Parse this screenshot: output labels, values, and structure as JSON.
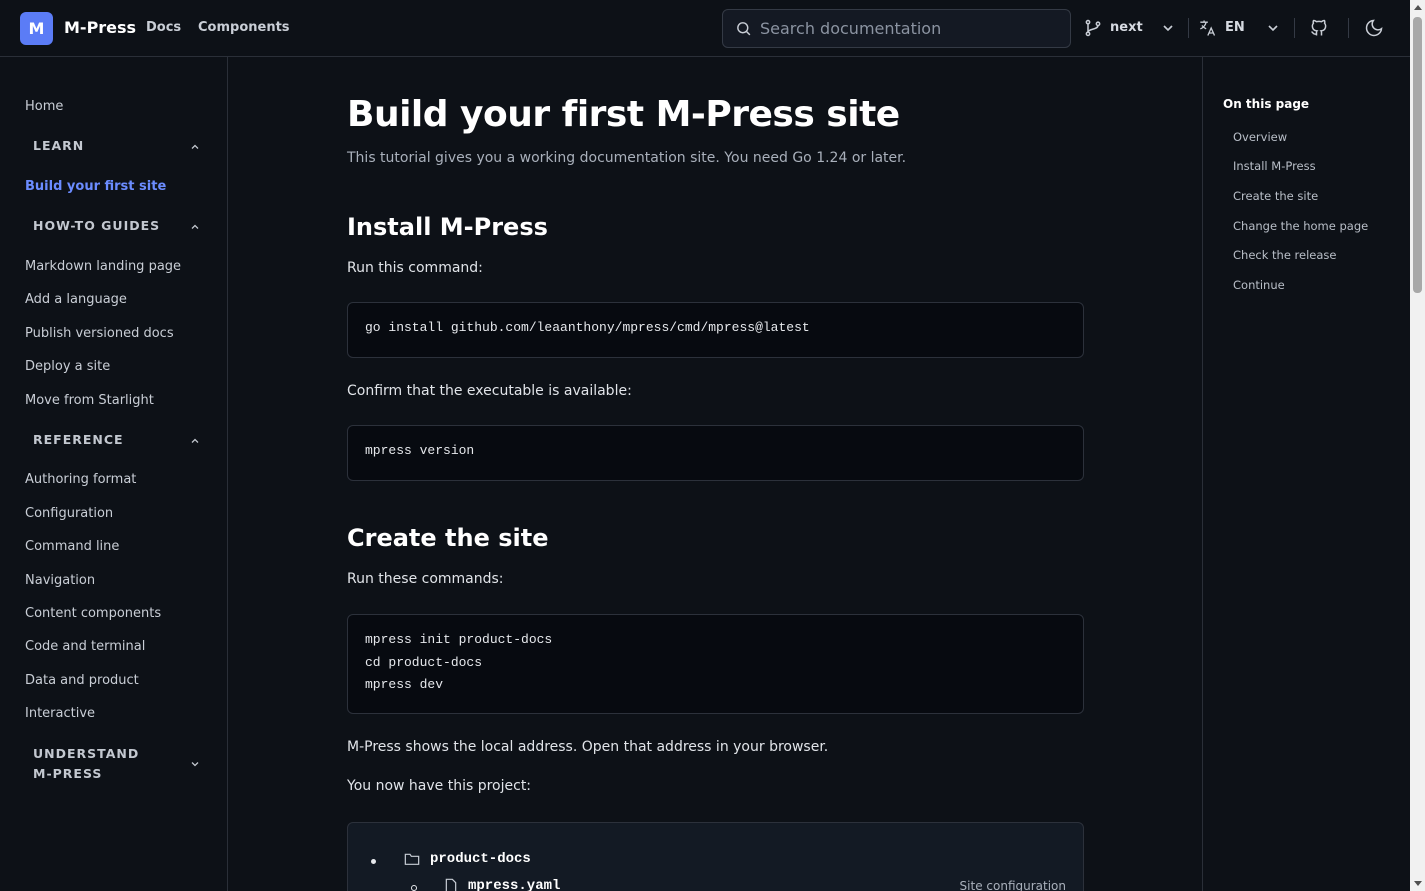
{
  "header": {
    "logo_letter": "M",
    "brand": "M-Press",
    "nav": [
      "Docs",
      "Components"
    ],
    "search_placeholder": "Search documentation",
    "version": "next",
    "language": "EN"
  },
  "sidebar": {
    "home": "Home",
    "groups": [
      {
        "title": "LEARN",
        "expanded": true,
        "items": [
          "Build your first site"
        ]
      },
      {
        "title": "HOW-TO GUIDES",
        "expanded": true,
        "items": [
          "Markdown landing page",
          "Add a language",
          "Publish versioned docs",
          "Deploy a site",
          "Move from Starlight"
        ]
      },
      {
        "title": "REFERENCE",
        "expanded": true,
        "items": [
          "Authoring format",
          "Configuration",
          "Command line",
          "Navigation",
          "Content components",
          "Code and terminal",
          "Data and product",
          "Interactive"
        ]
      },
      {
        "title": "UNDERSTAND M-PRESS",
        "expanded": false,
        "items": []
      }
    ],
    "active_item": "Build your first site"
  },
  "content": {
    "title": "Build your first M-Press site",
    "lede": "This tutorial gives you a working documentation site. You need Go 1.24 or later.",
    "install_heading": "Install M-Press",
    "install_intro": "Run this command:",
    "install_code": [
      "go install github.com/leaanthony/mpress/cmd/mpress@latest"
    ],
    "confirm_text": "Confirm that the executable is available:",
    "confirm_code": [
      "mpress version"
    ],
    "create_heading": "Create the site",
    "create_intro": "Run these commands:",
    "create_code": [
      "mpress init product-docs",
      "cd product-docs",
      "mpress dev"
    ],
    "address_text": "M-Press shows the local address. Open that address in your browser.",
    "project_text": "You now have this project:",
    "tree": {
      "root": "product-docs",
      "child": "mpress.yaml",
      "child_note": "Site configuration"
    }
  },
  "toc": {
    "title": "On this page",
    "items": [
      "Overview",
      "Install M-Press",
      "Create the site",
      "Change the home page",
      "Check the release",
      "Continue"
    ]
  },
  "colors": {
    "accent": "#5b7cf6",
    "active_link": "#6b8cff",
    "background": "#0d1117"
  },
  "icons": [
    "search-icon",
    "branch-icon",
    "translate-icon",
    "chevron-down-icon",
    "github-icon",
    "moon-icon",
    "chevron-up-icon",
    "folder-icon",
    "file-icon"
  ]
}
